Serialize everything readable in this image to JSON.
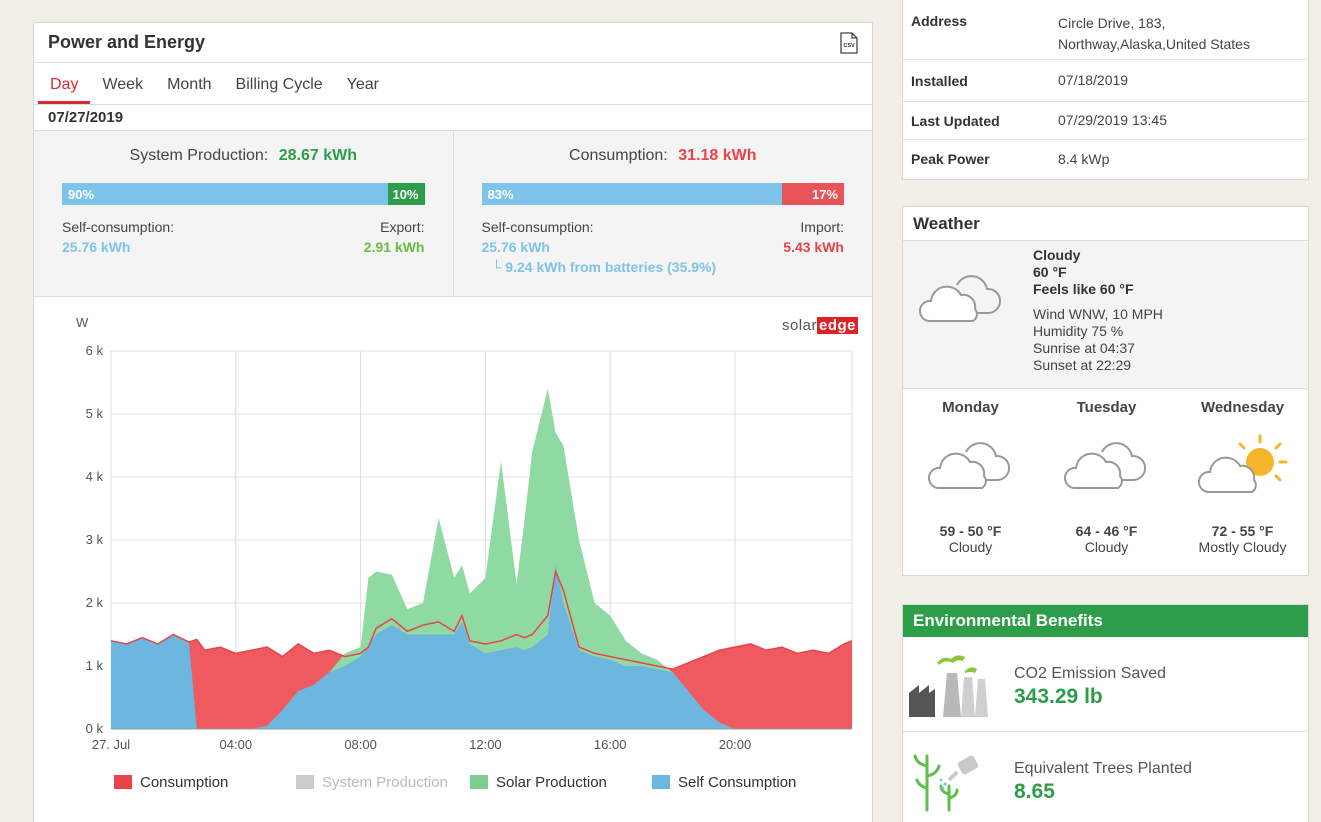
{
  "colors": {
    "production_green": "#2e9d49",
    "consumption_red": "#e8434a",
    "self_blue": "#7ec3ea",
    "solar_area": "#8fd9a2",
    "self_area": "#6cb6e0",
    "consumption_area": "#ee5a5f",
    "overlap_area": "#8f9fcf"
  },
  "power_energy": {
    "title": "Power and Energy",
    "csv_icon": "csv-file-icon",
    "csv_label": "CSV",
    "tabs": [
      "Day",
      "Week",
      "Month",
      "Billing Cycle",
      "Year"
    ],
    "active_tab": "Day",
    "date": "07/27/2019",
    "production": {
      "label": "System Production:",
      "value": "28.67 kWh",
      "self_pct": "90%",
      "export_pct": "10%",
      "self_label": "Self-consumption:",
      "self_value": "25.76 kWh",
      "export_label": "Export:",
      "export_value": "2.91 kWh"
    },
    "consumption": {
      "label": "Consumption:",
      "value": "31.18 kWh",
      "self_pct": "83%",
      "import_pct": "17%",
      "self_label": "Self-consumption:",
      "self_value": "25.76 kWh",
      "import_label": "Import:",
      "import_value": "5.43 kWh",
      "batteries_note": "└ 9.24 kWh from batteries (35.9%)"
    },
    "brand_solar": "solar",
    "brand_edge": "edge"
  },
  "chart_data": {
    "type": "area",
    "ylabel": "W",
    "y_ticks": [
      "0 k",
      "1 k",
      "2 k",
      "3 k",
      "4 k",
      "5 k",
      "6 k"
    ],
    "ylim": [
      0,
      6000
    ],
    "x_ticks": [
      "27. Jul",
      "04:00",
      "08:00",
      "12:00",
      "16:00",
      "20:00"
    ],
    "x_tick_hours": [
      0,
      4,
      8,
      12,
      16,
      20
    ],
    "xlim_hours": [
      0,
      23.75
    ],
    "grid": true,
    "legend_position": "bottom",
    "legend": [
      {
        "name": "Consumption",
        "color": "#e8434a",
        "enabled": true
      },
      {
        "name": "System Production",
        "color": "#cccccc",
        "enabled": false
      },
      {
        "name": "Solar Production",
        "color": "#7fce91",
        "enabled": true
      },
      {
        "name": "Self Consumption",
        "color": "#6cb6e0",
        "enabled": true
      }
    ],
    "hours": [
      0,
      0.5,
      1,
      1.5,
      2,
      2.5,
      2.75,
      3,
      3.5,
      4,
      4.5,
      5,
      5.5,
      6,
      6.5,
      7,
      7.5,
      8,
      8.25,
      8.5,
      9,
      9.5,
      10,
      10.5,
      11,
      11.25,
      11.5,
      12,
      12.5,
      13,
      13.25,
      13.5,
      14,
      14.25,
      14.5,
      15,
      15.5,
      16,
      16.5,
      17,
      17.5,
      18,
      18.5,
      19,
      19.5,
      20,
      20.5,
      21,
      21.5,
      22,
      22.5,
      23,
      23.5,
      23.75
    ],
    "consumption": [
      1400,
      1350,
      1450,
      1350,
      1500,
      1380,
      1420,
      1250,
      1300,
      1200,
      1250,
      1300,
      1150,
      1350,
      1200,
      1250,
      1150,
      1200,
      1300,
      1600,
      1750,
      1550,
      1650,
      1700,
      1550,
      1800,
      1400,
      1350,
      1400,
      1500,
      1450,
      1500,
      1800,
      2500,
      2200,
      1300,
      1200,
      1150,
      1100,
      1050,
      1000,
      950,
      1050,
      1150,
      1250,
      1300,
      1350,
      1250,
      1300,
      1200,
      1250,
      1200,
      1350,
      1400
    ],
    "solar_production": [
      0,
      0,
      0,
      0,
      0,
      0,
      0,
      0,
      0,
      0,
      0,
      50,
      300,
      600,
      700,
      900,
      1200,
      1300,
      2400,
      2500,
      2450,
      1900,
      2000,
      3350,
      2400,
      2600,
      2150,
      2400,
      4250,
      2300,
      3300,
      4400,
      5400,
      4700,
      4500,
      3000,
      2000,
      1800,
      1400,
      1200,
      1100,
      900,
      600,
      300,
      100,
      0,
      0,
      0,
      0,
      0,
      0,
      0,
      0,
      0
    ],
    "self_consumption": [
      1400,
      1350,
      1450,
      1350,
      1500,
      1380,
      0,
      0,
      0,
      0,
      0,
      50,
      300,
      600,
      700,
      900,
      1000,
      1150,
      1300,
      1500,
      1650,
      1500,
      1500,
      1500,
      1500,
      1700,
      1350,
      1200,
      1250,
      1300,
      1250,
      1300,
      1500,
      2600,
      2000,
      1250,
      1150,
      1100,
      1000,
      1000,
      950,
      900,
      600,
      300,
      100,
      0,
      0,
      0,
      0,
      0,
      0,
      0,
      0,
      0
    ]
  },
  "info": {
    "rows": [
      {
        "key": "Address",
        "value": "Circle Drive, 183,",
        "value2": "Northway,Alaska,United States"
      },
      {
        "key": "Installed",
        "value": "07/18/2019"
      },
      {
        "key": "Last Updated",
        "value": "07/29/2019 13:45"
      },
      {
        "key": "Peak Power",
        "value": "8.4 kWp"
      }
    ]
  },
  "weather": {
    "title": "Weather",
    "current": {
      "icon": "cloud-icon",
      "condition": "Cloudy",
      "temp": "60 °F",
      "feels_like": "Feels like 60 °F",
      "wind": "Wind WNW, 10 MPH",
      "humidity": "Humidity 75 %",
      "sunrise": "Sunrise at 04:37",
      "sunset": "Sunset at 22:29"
    },
    "forecast": [
      {
        "day": "Monday",
        "temp": "59 - 50 °F",
        "condition": "Cloudy",
        "icon": "cloud-icon"
      },
      {
        "day": "Tuesday",
        "temp": "64 - 46 °F",
        "condition": "Cloudy",
        "icon": "cloud-icon"
      },
      {
        "day": "Wednesday",
        "temp": "72 - 55 °F",
        "condition": "Mostly Cloudy",
        "icon": "sun-cloud-icon"
      }
    ]
  },
  "env": {
    "title": "Environmental Benefits",
    "co2_label": "CO2 Emission Saved",
    "co2_value": "343.29 lb",
    "co2_icon": "factory-icon",
    "trees_label": "Equivalent Trees Planted",
    "trees_value": "8.65",
    "trees_icon": "tree-watering-icon"
  }
}
